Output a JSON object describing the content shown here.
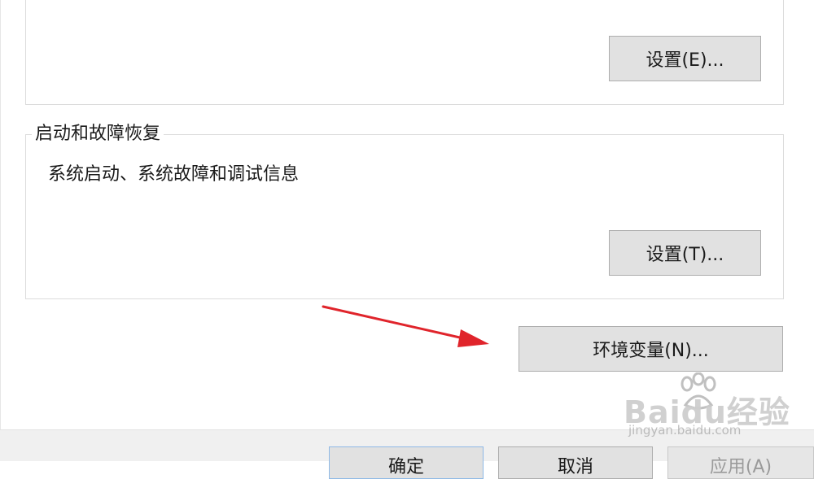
{
  "performance": {
    "settings_button_label": "设置(E)..."
  },
  "startup_recovery": {
    "group_title": "启动和故障恢复",
    "description": "系统启动、系统故障和调试信息",
    "settings_button_label": "设置(T)..."
  },
  "env_vars_button_label": "环境变量(N)...",
  "footer": {
    "ok_label": "确定",
    "cancel_label": "取消",
    "apply_label": "应用(A)"
  },
  "annotation": {
    "arrow_color": "#e0242b"
  },
  "watermark": {
    "logo_text": "Baidu经验",
    "site_text": "jingyan.baidu.com"
  }
}
